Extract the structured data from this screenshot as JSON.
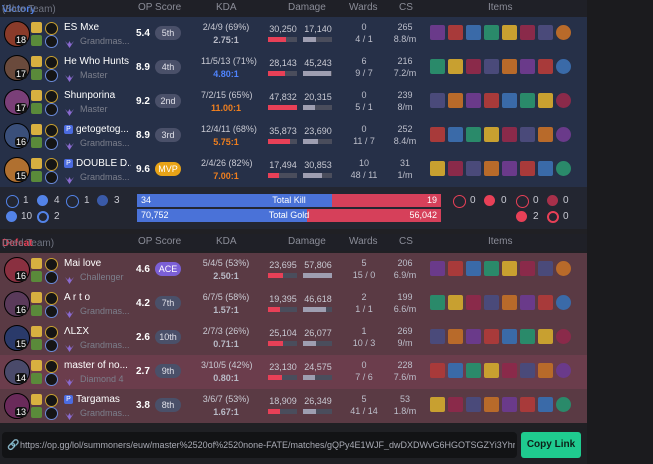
{
  "blue_header": {
    "result": "Victory",
    "team": "(Blue Team)",
    "op_score": "OP Score",
    "kda": "KDA",
    "damage": "Damage",
    "wards": "Wards",
    "cs": "CS",
    "items": "Items"
  },
  "red_header": {
    "result": "Defeat",
    "team": "(Red Team)",
    "op_score": "OP Score",
    "kda": "KDA",
    "damage": "Damage",
    "wards": "Wards",
    "cs": "CS",
    "items": "Items"
  },
  "colors": {
    "victory": "#5383e8",
    "defeat": "#e84057",
    "mvp": "#e8a317",
    "ace": "#7b5fd6",
    "dealt": "#e84057",
    "taken": "#9e9eb1",
    "total_blue": "#4a72d8",
    "total_red": "#d6405a",
    "copy": "#1fcb8f"
  },
  "blue_players": [
    {
      "name": "ES Mxe",
      "rank": "Grandmas...",
      "level": "18",
      "score": "5.4",
      "place": "5th",
      "kda_line": "2/4/9 (69%)",
      "kda_ratio": "2.75:1",
      "kda_color": "#b9bbc7",
      "dmg_dealt": "30,250",
      "dmg_taken": "17,140",
      "dealt_frac": 0.63,
      "taken_frac": 0.45,
      "wards": "0",
      "wards_detail": "4 / 1",
      "cs": "265",
      "cs_rate": "8.8/m",
      "champ_color": "#8a3b2a",
      "tag": false
    },
    {
      "name": "He Who Hunts",
      "rank": "Master",
      "level": "17",
      "score": "8.9",
      "place": "4th",
      "kda_line": "11/5/13 (71%)",
      "kda_ratio": "4.80:1",
      "kda_color": "#4f84ff",
      "dmg_dealt": "28,143",
      "dmg_taken": "45,243",
      "dealt_frac": 0.59,
      "taken_frac": 0.95,
      "wards": "6",
      "wards_detail": "9 / 7",
      "cs": "216",
      "cs_rate": "7.2/m",
      "champ_color": "#6a4a3c",
      "tag": false
    },
    {
      "name": "Shunporina",
      "rank": "Master",
      "level": "17",
      "score": "9.2",
      "place": "2nd",
      "kda_line": "7/2/15 (65%)",
      "kda_ratio": "11.00:1",
      "kda_color": "#f07f1e",
      "dmg_dealt": "47,832",
      "dmg_taken": "20,315",
      "dealt_frac": 1.0,
      "taken_frac": 0.43,
      "wards": "0",
      "wards_detail": "5 / 1",
      "cs": "239",
      "cs_rate": "8/m",
      "champ_color": "#7a3f78",
      "tag": false
    },
    {
      "name": "getogetog...",
      "rank": "Grandmas...",
      "level": "16",
      "score": "8.9",
      "place": "3rd",
      "kda_line": "12/4/11 (68%)",
      "kda_ratio": "5.75:1",
      "kda_color": "#f07f1e",
      "dmg_dealt": "35,873",
      "dmg_taken": "23,690",
      "dealt_frac": 0.75,
      "taken_frac": 0.5,
      "wards": "0",
      "wards_detail": "11 / 7",
      "cs": "252",
      "cs_rate": "8.4/m",
      "champ_color": "#3a4f7a",
      "tag": true
    },
    {
      "name": "DOUBLE D...",
      "rank": "Grandmas...",
      "level": "15",
      "score": "9.6",
      "place": "MVP",
      "kda_line": "2/4/26 (82%)",
      "kda_ratio": "7.00:1",
      "kda_color": "#f07f1e",
      "dmg_dealt": "17,494",
      "dmg_taken": "30,853",
      "dealt_frac": 0.37,
      "taken_frac": 0.65,
      "wards": "10",
      "wards_detail": "48 / 11",
      "cs": "31",
      "cs_rate": "1/m",
      "champ_color": "#b07030",
      "tag": true
    }
  ],
  "red_players": [
    {
      "name": "Mai love",
      "rank": "Challenger",
      "level": "16",
      "score": "4.6",
      "place": "ACE",
      "kda_line": "5/4/5 (53%)",
      "kda_ratio": "2.50:1",
      "kda_color": "#b9bbc7",
      "dmg_dealt": "23,695",
      "dmg_taken": "57,806",
      "dealt_frac": 0.5,
      "taken_frac": 1.0,
      "wards": "5",
      "wards_detail": "15 / 0",
      "cs": "206",
      "cs_rate": "6.9/m",
      "champ_color": "#8a3040",
      "tag": false
    },
    {
      "name": "A r t o",
      "rank": "Grandmas...",
      "level": "16",
      "score": "4.2",
      "place": "7th",
      "kda_line": "6/7/5 (58%)",
      "kda_ratio": "1.57:1",
      "kda_color": "#b9bbc7",
      "dmg_dealt": "19,395",
      "dmg_taken": "46,618",
      "dealt_frac": 0.41,
      "taken_frac": 0.8,
      "wards": "2",
      "wards_detail": "1 / 1",
      "cs": "199",
      "cs_rate": "6.6/m",
      "champ_color": "#5a3a5a",
      "tag": false
    },
    {
      "name": "ΛLΣX",
      "rank": "Grandmas...",
      "level": "15",
      "score": "2.6",
      "place": "10th",
      "kda_line": "2/7/3 (26%)",
      "kda_ratio": "0.71:1",
      "kda_color": "#b9bbc7",
      "dmg_dealt": "25,104",
      "dmg_taken": "26,077",
      "dealt_frac": 0.53,
      "taken_frac": 0.45,
      "wards": "1",
      "wards_detail": "10 / 3",
      "cs": "269",
      "cs_rate": "9/m",
      "champ_color": "#2a3a6a",
      "tag": false
    },
    {
      "name": "master of no...",
      "rank": "Diamond 4",
      "level": "14",
      "score": "2.7",
      "place": "9th",
      "kda_line": "3/10/5 (42%)",
      "kda_ratio": "0.80:1",
      "kda_color": "#b9bbc7",
      "dmg_dealt": "23,130",
      "dmg_taken": "24,575",
      "dealt_frac": 0.48,
      "taken_frac": 0.42,
      "wards": "0",
      "wards_detail": "7 / 6",
      "cs": "228",
      "cs_rate": "7.6/m",
      "champ_color": "#4a4a6a",
      "tag": false
    },
    {
      "name": "Targamas",
      "rank": "Grandmas...",
      "level": "13",
      "score": "3.8",
      "place": "8th",
      "kda_line": "3/6/7 (53%)",
      "kda_ratio": "1.67:1",
      "kda_color": "#b9bbc7",
      "dmg_dealt": "18,909",
      "dmg_taken": "26,349",
      "dealt_frac": 0.4,
      "taken_frac": 0.45,
      "wards": "5",
      "wards_detail": "41 / 14",
      "cs": "53",
      "cs_rate": "1.8/m",
      "champ_color": "#6a2a5a",
      "tag": true
    }
  ],
  "objectives": {
    "blue": {
      "baron": "1",
      "dragon": "4",
      "herald": "1",
      "grubs": "3",
      "tower": "10",
      "inhib": "2"
    },
    "red": {
      "baron": "0",
      "dragon": "0",
      "herald": "0",
      "grubs": "0",
      "tower": "2",
      "inhib": "0"
    }
  },
  "totals": {
    "kill_label": "Total Kill",
    "blue_kills": "34",
    "red_kills": "19",
    "blue_kill_frac": 0.64,
    "gold_label": "Total Gold",
    "blue_gold": "70,752",
    "red_gold": "56,042",
    "blue_gold_frac": 0.56
  },
  "url_bar": {
    "url": "https://op.gg/lol/summoners/euw/master%2520of%2520none-FATE/matches/gQPy4E1WJF_dwDXDWvG6HGOTSGZYi3Yhr...",
    "copy_label": "Copy Link"
  },
  "icons": {
    "link": "link-icon",
    "baron": "baron-icon",
    "dragon": "dragon-icon",
    "herald": "herald-icon",
    "grubs": "grubs-icon",
    "tower": "tower-icon",
    "inhibitor": "inhibitor-icon"
  }
}
